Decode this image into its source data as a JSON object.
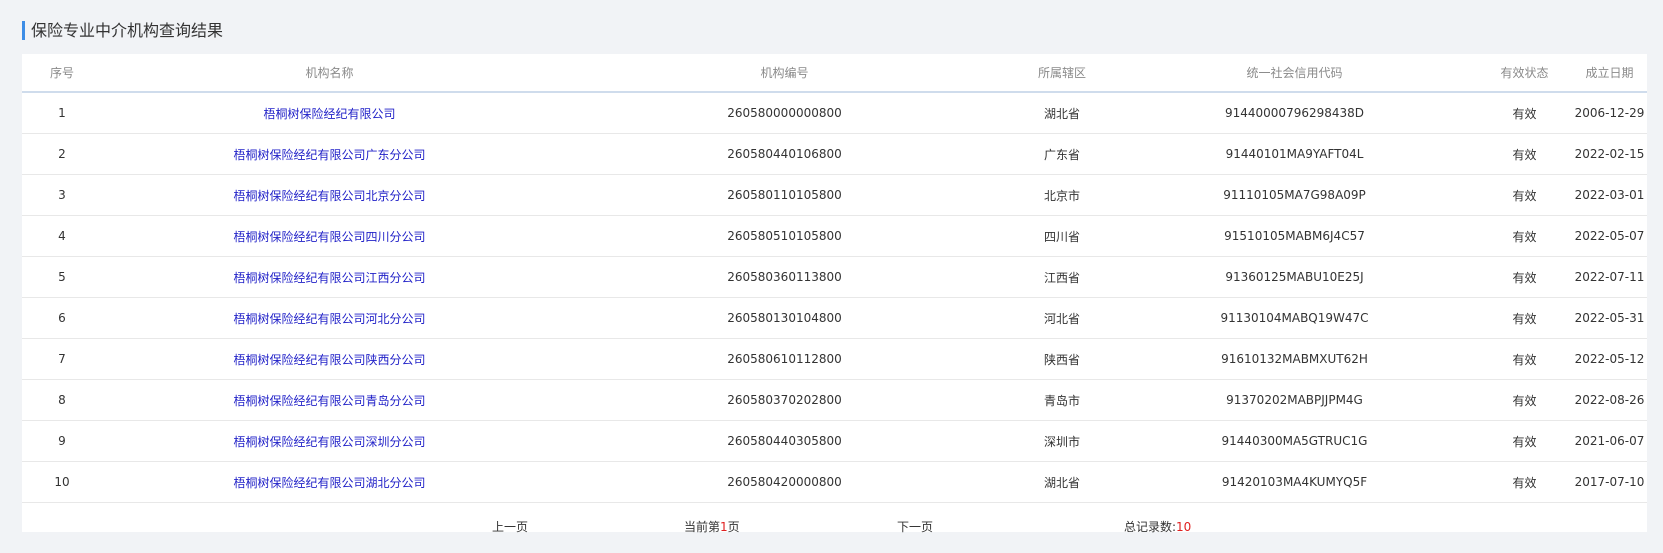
{
  "page": {
    "title": "保险专业中介机构查询结果"
  },
  "table": {
    "headers": {
      "index": "序号",
      "name": "机构名称",
      "code": "机构编号",
      "region": "所属辖区",
      "credit_code": "统一社会信用代码",
      "status": "有效状态",
      "date": "成立日期"
    },
    "rows": [
      {
        "index": "1",
        "name": "梧桐树保险经纪有限公司",
        "code": "260580000000800",
        "region": "湖北省",
        "credit_code": "91440000796298438D",
        "status": "有效",
        "date": "2006-12-29"
      },
      {
        "index": "2",
        "name": "梧桐树保险经纪有限公司广东分公司",
        "code": "260580440106800",
        "region": "广东省",
        "credit_code": "91440101MA9YAFT04L",
        "status": "有效",
        "date": "2022-02-15"
      },
      {
        "index": "3",
        "name": "梧桐树保险经纪有限公司北京分公司",
        "code": "260580110105800",
        "region": "北京市",
        "credit_code": "91110105MA7G98A09P",
        "status": "有效",
        "date": "2022-03-01"
      },
      {
        "index": "4",
        "name": "梧桐树保险经纪有限公司四川分公司",
        "code": "260580510105800",
        "region": "四川省",
        "credit_code": "91510105MABM6J4C57",
        "status": "有效",
        "date": "2022-05-07"
      },
      {
        "index": "5",
        "name": "梧桐树保险经纪有限公司江西分公司",
        "code": "260580360113800",
        "region": "江西省",
        "credit_code": "91360125MABU10E25J",
        "status": "有效",
        "date": "2022-07-11"
      },
      {
        "index": "6",
        "name": "梧桐树保险经纪有限公司河北分公司",
        "code": "260580130104800",
        "region": "河北省",
        "credit_code": "91130104MABQ19W47C",
        "status": "有效",
        "date": "2022-05-31"
      },
      {
        "index": "7",
        "name": "梧桐树保险经纪有限公司陕西分公司",
        "code": "260580610112800",
        "region": "陕西省",
        "credit_code": "91610132MABMXUT62H",
        "status": "有效",
        "date": "2022-05-12"
      },
      {
        "index": "8",
        "name": "梧桐树保险经纪有限公司青岛分公司",
        "code": "260580370202800",
        "region": "青岛市",
        "credit_code": "91370202MABPJJPM4G",
        "status": "有效",
        "date": "2022-08-26"
      },
      {
        "index": "9",
        "name": "梧桐树保险经纪有限公司深圳分公司",
        "code": "260580440305800",
        "region": "深圳市",
        "credit_code": "91440300MA5GTRUC1G",
        "status": "有效",
        "date": "2021-06-07"
      },
      {
        "index": "10",
        "name": "梧桐树保险经纪有限公司湖北分公司",
        "code": "260580420000800",
        "region": "湖北省",
        "credit_code": "91420103MA4KUMYQ5F",
        "status": "有效",
        "date": "2017-07-10"
      }
    ]
  },
  "pager": {
    "prev_label": "上一页",
    "current_prefix": "当前第",
    "current_page": "1",
    "current_suffix": "页",
    "next_label": "下一页",
    "total_label": "总记录数:",
    "total_count": "10"
  },
  "colors": {
    "accent": "#3d8de6",
    "link": "#2222c8",
    "highlight": "#e02020",
    "background": "#f1f3f6"
  }
}
